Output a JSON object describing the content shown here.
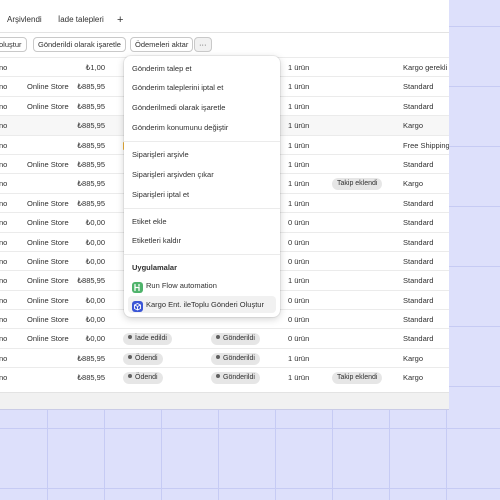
{
  "tabs": [
    "Arşivlendi",
    "İade talepleri",
    "+"
  ],
  "actions": [
    "oluştur",
    "Gönderildi olarak işaretle",
    "Ödemeleri aktar",
    "···"
  ],
  "colors": {
    "background": "#dde0fb",
    "grid": "#c6cbf4",
    "panel": "#ffffff",
    "flow_icon": "#4fb36b",
    "kargo_icon": "#3b56d6"
  },
  "rows": [
    {
      "name": "no",
      "channel": "",
      "total": "₺1,00",
      "payment": "",
      "fulfillment": "",
      "items": "1 ürün",
      "tag": "",
      "delivery": "Kargo gerekli"
    },
    {
      "name": "no",
      "channel": "Online Store",
      "total": "₺885,95",
      "payment": "",
      "fulfillment": "",
      "items": "1 ürün",
      "tag": "",
      "delivery": "Standard"
    },
    {
      "name": "no",
      "channel": "Online Store",
      "total": "₺885,95",
      "payment": "",
      "fulfillment": "",
      "items": "1 ürün",
      "tag": "",
      "delivery": "Standard"
    },
    {
      "name": "no",
      "channel": "",
      "total": "₺885,95",
      "payment": "",
      "fulfillment": "",
      "items": "1 ürün",
      "tag": "",
      "delivery": "Kargo"
    },
    {
      "name": "no",
      "channel": "",
      "total": "₺885,95",
      "payment": "",
      "fulfillment": "",
      "items": "1 ürün",
      "tag": "",
      "delivery": "Free Shipping"
    },
    {
      "name": "no",
      "channel": "Online Store",
      "total": "₺885,95",
      "payment": "",
      "fulfillment": "",
      "items": "1 ürün",
      "tag": "",
      "delivery": "Standard"
    },
    {
      "name": "no",
      "channel": "",
      "total": "₺885,95",
      "payment": "",
      "fulfillment": "",
      "items": "1 ürün",
      "tag": "Takip eklendi",
      "delivery": "Kargo"
    },
    {
      "name": "no",
      "channel": "Online Store",
      "total": "₺885,95",
      "payment": "",
      "fulfillment": "",
      "items": "1 ürün",
      "tag": "",
      "delivery": "Standard"
    },
    {
      "name": "no",
      "channel": "Online Store",
      "total": "₺0,00",
      "payment": "",
      "fulfillment": "",
      "items": "0 ürün",
      "tag": "",
      "delivery": "Standard"
    },
    {
      "name": "no",
      "channel": "Online Store",
      "total": "₺0,00",
      "payment": "",
      "fulfillment": "",
      "items": "0 ürün",
      "tag": "",
      "delivery": "Standard"
    },
    {
      "name": "no",
      "channel": "Online Store",
      "total": "₺0,00",
      "payment": "",
      "fulfillment": "",
      "items": "0 ürün",
      "tag": "",
      "delivery": "Standard"
    },
    {
      "name": "no",
      "channel": "Online Store",
      "total": "₺885,95",
      "payment": "",
      "fulfillment": "",
      "items": "1 ürün",
      "tag": "",
      "delivery": "Standard"
    },
    {
      "name": "no",
      "channel": "Online Store",
      "total": "₺0,00",
      "payment": "",
      "fulfillment": "",
      "items": "0 ürün",
      "tag": "",
      "delivery": "Standard"
    },
    {
      "name": "no",
      "channel": "Online Store",
      "total": "₺0,00",
      "payment": "",
      "fulfillment": "",
      "items": "0 ürün",
      "tag": "",
      "delivery": "Standard"
    },
    {
      "name": "no",
      "channel": "Online Store",
      "total": "₺0,00",
      "payment": "İade edildi",
      "fulfillment": "Gönderildi",
      "items": "0 ürün",
      "tag": "",
      "delivery": "Standard"
    },
    {
      "name": "no",
      "channel": "",
      "total": "₺885,95",
      "payment": "Ödendi",
      "fulfillment": "Gönderildi",
      "items": "1 ürün",
      "tag": "",
      "delivery": "Kargo"
    },
    {
      "name": "no",
      "channel": "",
      "total": "₺885,95",
      "payment": "Ödendi",
      "fulfillment": "Gönderildi",
      "items": "1 ürün",
      "tag": "Takip eklendi",
      "delivery": "Kargo"
    }
  ],
  "menu": {
    "items": [
      "Gönderim talep et",
      "Gönderim taleplerini iptal et",
      "Gönderilmedi olarak işaretle",
      "Gönderim konumunu değiştir",
      "Siparişleri arşivle",
      "Siparişleri arşivden çıkar",
      "Siparişleri iptal et",
      "Etiket ekle",
      "Etiketleri kaldır"
    ],
    "apps_heading": "Uygulamalar",
    "apps": [
      {
        "label": "Run Flow automation",
        "icon": "flow-icon"
      },
      {
        "label": "Kargo Ent. ileToplu Gönderi Oluştur",
        "icon": "kargo-icon"
      }
    ]
  }
}
